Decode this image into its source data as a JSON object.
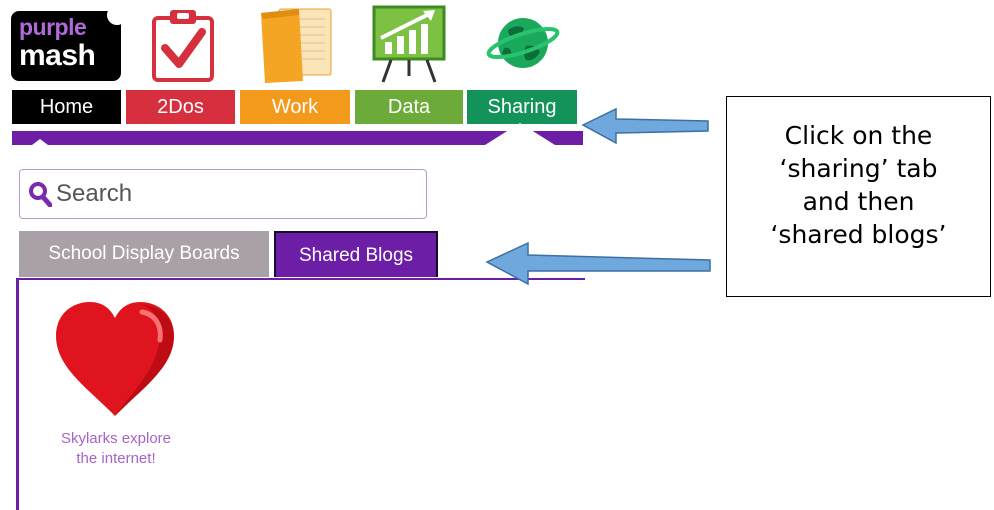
{
  "logo": {
    "line1": "purple",
    "line2": "mash"
  },
  "nav": {
    "tabs": [
      {
        "label": "Home",
        "color": "#000000"
      },
      {
        "label": "2Dos",
        "color": "#d62f3d"
      },
      {
        "label": "Work",
        "color": "#f39a1c"
      },
      {
        "label": "Data",
        "color": "#6cab3a"
      },
      {
        "label": "Sharing",
        "color": "#13925a"
      }
    ],
    "bar_color": "#6c1fa6"
  },
  "search": {
    "placeholder": "Search"
  },
  "subtabs": [
    {
      "label": "School Display Boards",
      "color": "#a9a0a8"
    },
    {
      "label": "Shared Blogs",
      "color": "#6c1fa6"
    }
  ],
  "blog": {
    "line1": "Skylarks explore",
    "line2": "the internet!"
  },
  "callout": {
    "lines": [
      "Click on the",
      "‘sharing’ tab",
      "and then",
      "‘shared blogs’"
    ]
  },
  "icons": [
    "clipboard-check-icon",
    "folder-icon",
    "chart-board-icon",
    "globe-icon",
    "heart-icon",
    "search-icon",
    "arrow-left-icon"
  ]
}
